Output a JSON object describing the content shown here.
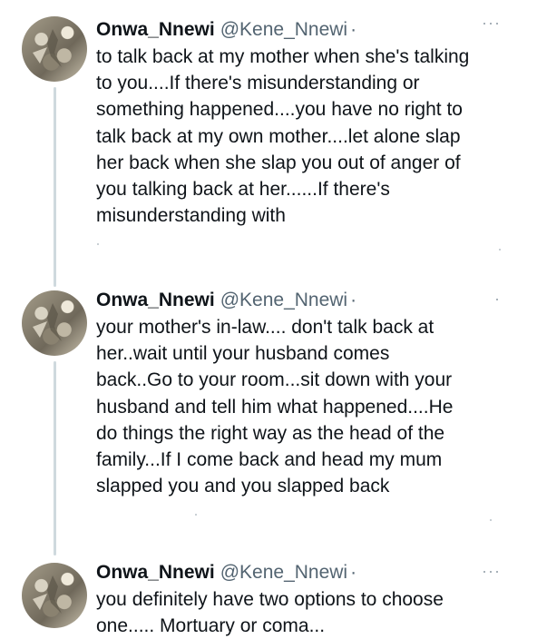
{
  "tweets": [
    {
      "author_name": "Onwa_Nnewi",
      "handle": "@Kene_Nnewi",
      "separator": "·",
      "more_label": "···",
      "text": "to talk back at my mother when she's talking\nto you....If there's misunderstanding or\nsomething happened....you have no right to\ntalk back at my own mother....let alone slap\nher back when she slap you out of anger of\nyou talking back at her......If there's\nmisunderstanding with"
    },
    {
      "author_name": "Onwa_Nnewi",
      "handle": "@Kene_Nnewi",
      "separator": "·",
      "more_label": "·",
      "text": "your mother's in-law.... don't talk back at\nher..wait until your husband comes\nback..Go to your room...sit down with your\nhusband and tell him what happened....He\ndo things the right way as the head of the\nfamily...If I come back and head my mum\nslapped you and you slapped back"
    },
    {
      "author_name": "Onwa_Nnewi",
      "handle": "@Kene_Nnewi",
      "separator": "·",
      "more_label": "···",
      "text": "you definitely have two options to choose\none..... Mortuary or coma..."
    }
  ]
}
